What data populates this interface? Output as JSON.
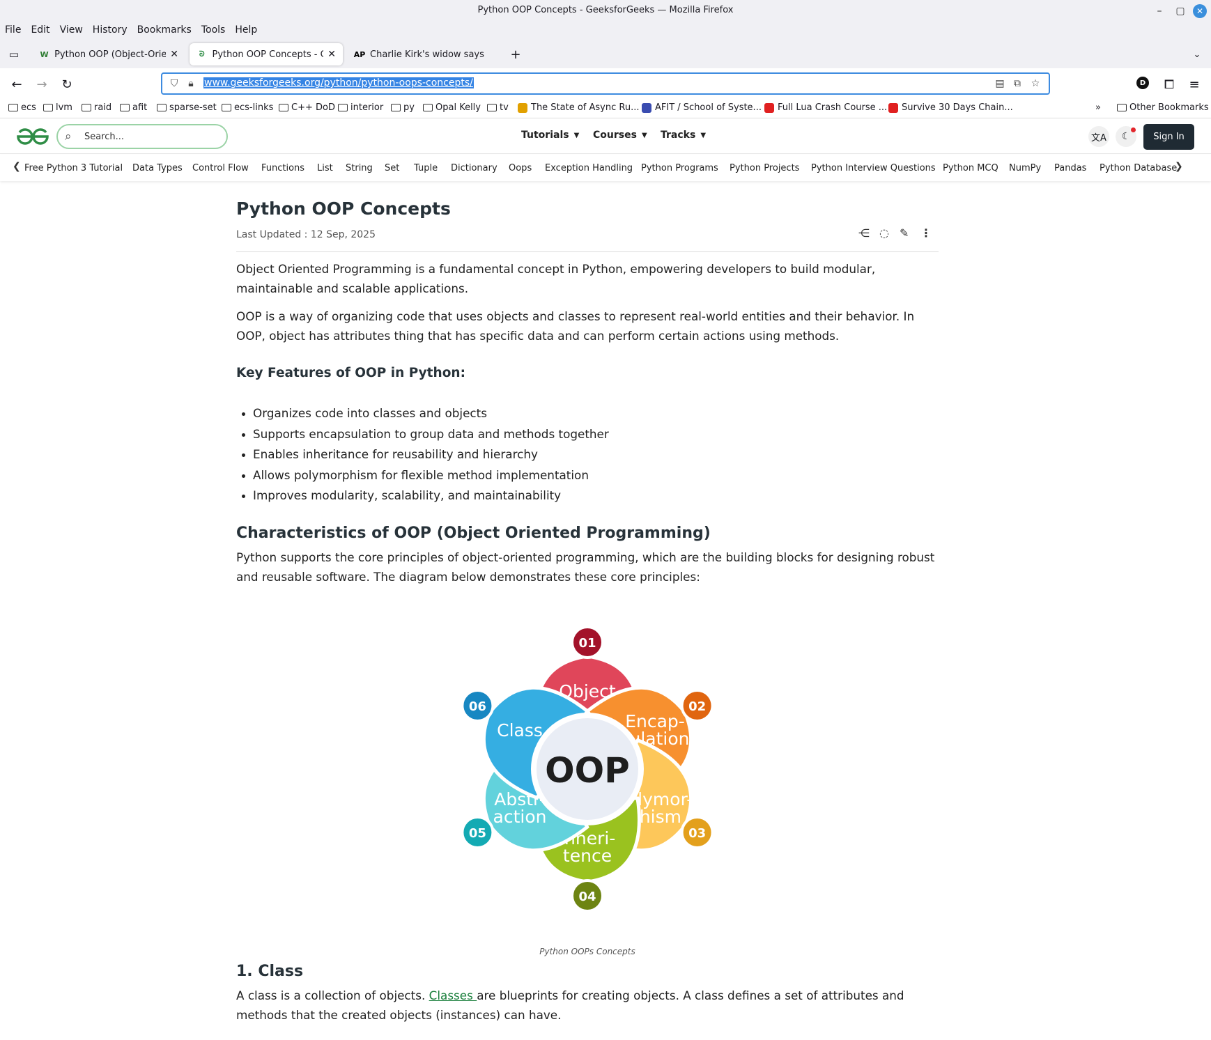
{
  "window": {
    "title": "Python OOP Concepts - GeeksforGeeks — Mozilla Firefox"
  },
  "menu": [
    "File",
    "Edit",
    "View",
    "History",
    "Bookmarks",
    "Tools",
    "Help"
  ],
  "tabs": [
    {
      "label": "Python OOP (Object-Oriented",
      "favicon": "W",
      "active": false
    },
    {
      "label": "Python OOP Concepts - GeeksforGeeks",
      "favicon": "gfg",
      "active": true
    },
    {
      "label": "Charlie Kirk's widow says she",
      "favicon": "AP",
      "active": false
    }
  ],
  "url": "www.geeksforgeeks.org/python/python-oops-concepts/",
  "bookmarks": [
    {
      "label": "ecs",
      "type": "folder"
    },
    {
      "label": "lvm",
      "type": "folder"
    },
    {
      "label": "raid",
      "type": "folder"
    },
    {
      "label": "afit",
      "type": "folder"
    },
    {
      "label": "sparse-set",
      "type": "folder"
    },
    {
      "label": "ecs-links",
      "type": "folder"
    },
    {
      "label": "C++ DoD",
      "type": "folder"
    },
    {
      "label": "interior",
      "type": "folder"
    },
    {
      "label": "py",
      "type": "folder"
    },
    {
      "label": "Opal Kelly",
      "type": "folder"
    },
    {
      "label": "tv",
      "type": "folder"
    },
    {
      "label": "The State of Async Ru...",
      "type": "site"
    },
    {
      "label": "AFIT / School of Syste...",
      "type": "site"
    },
    {
      "label": "Full Lua Crash Course ...",
      "type": "site"
    },
    {
      "label": "Survive 30 Days Chain...",
      "type": "site"
    }
  ],
  "other_bookmarks": "Other Bookmarks",
  "site": {
    "search_placeholder": "Search...",
    "nav": [
      "Tutorials",
      "Courses",
      "Tracks"
    ],
    "signin": "Sign In",
    "brand_color": "#2f8d46"
  },
  "subnav": [
    "Free Python 3 Tutorial",
    "Data Types",
    "Control Flow",
    "Functions",
    "List",
    "String",
    "Set",
    "Tuple",
    "Dictionary",
    "Oops",
    "Exception Handling",
    "Python Programs",
    "Python Projects",
    "Python Interview Questions",
    "Python MCQ",
    "NumPy",
    "Pandas",
    "Python Database"
  ],
  "article": {
    "title": "Python OOP Concepts",
    "updated": "Last Updated : 12 Sep, 2025",
    "intro1": "Object Oriented Programming is a fundamental concept in Python, empowering developers to build modular, maintainable and scalable applications.",
    "intro2": "OOP is a way of organizing code that uses objects and classes to represent real-world entities and their behavior. In OOP, object has attributes thing that has specific data and can perform certain actions using methods.",
    "features_heading": "Key Features of OOP in Python:",
    "features": [
      "Organizes code into classes and objects",
      "Supports encapsulation to group data and methods together",
      "Enables inheritance for reusability and hierarchy",
      "Allows polymorphism for flexible method implementation",
      "Improves modularity, scalability, and maintainability"
    ],
    "char_heading": "Characteristics of OOP (Object Oriented Programming)",
    "char_text": "Python supports the core principles of object-oriented programming, which are the building blocks for designing robust and reusable software. The diagram below demonstrates these core principles:",
    "diagram": {
      "center": "OOP",
      "petals": [
        {
          "num": "01",
          "line1": "Object",
          "line2": "",
          "color": "#e0465a",
          "badge": "#a3122a"
        },
        {
          "num": "02",
          "line1": "Encap-",
          "line2": "sulation",
          "color": "#f7902f",
          "badge": "#e0650f"
        },
        {
          "num": "03",
          "line1": "Polymor-",
          "line2": "phism",
          "color": "#fdc75a",
          "badge": "#e3a01c"
        },
        {
          "num": "04",
          "line1": "Inheri-",
          "line2": "tence",
          "color": "#9ac21f",
          "badge": "#6d8412"
        },
        {
          "num": "05",
          "line1": "Abstr-",
          "line2": "action",
          "color": "#62d2dc",
          "badge": "#13aab3"
        },
        {
          "num": "06",
          "line1": "Class",
          "line2": "",
          "color": "#35aee2",
          "badge": "#1787c2"
        }
      ],
      "caption": "Python OOPs Concepts"
    },
    "class_heading": "1. Class",
    "class_text_pre": "A class is a collection of objects. ",
    "class_link": "Classes ",
    "class_text_post": "are blueprints for creating objects. A class defines a set of attributes and methods that the created objects (instances) can have."
  }
}
